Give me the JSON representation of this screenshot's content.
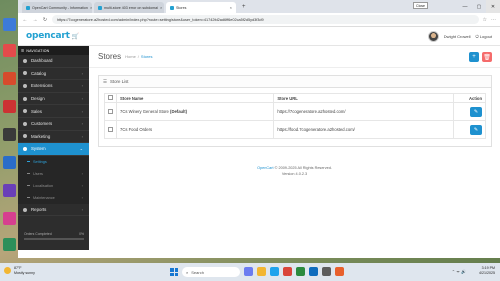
{
  "browser": {
    "tabs": [
      {
        "label": "OpenCart Community - Information",
        "active": false
      },
      {
        "label": "multi-store 403 error on subdomai",
        "active": false
      },
      {
        "label": "Stores",
        "active": true
      }
    ],
    "close_tooltip": "Close",
    "url": "https://7cogeneratore.a2hosted.com/admin/index.php?route=setting/store&user_token=41742fd2ad6ff6e02ca5f2d5yd3f3d9"
  },
  "header": {
    "logo": "opencart",
    "user_name": "Dwight Crowell",
    "logout_label": "Logout"
  },
  "sidebar": {
    "nav_title": "NAVIGATION",
    "items": [
      {
        "label": "Dashboard",
        "icon": "dashboard-icon",
        "chevron": false
      },
      {
        "label": "Catalog",
        "icon": "tags-icon",
        "chevron": true
      },
      {
        "label": "Extensions",
        "icon": "puzzle-icon",
        "chevron": true
      },
      {
        "label": "Design",
        "icon": "monitor-icon",
        "chevron": true
      },
      {
        "label": "Sales",
        "icon": "cart-icon",
        "chevron": true
      },
      {
        "label": "Customers",
        "icon": "user-icon",
        "chevron": true
      },
      {
        "label": "Marketing",
        "icon": "share-icon",
        "chevron": true
      },
      {
        "label": "System",
        "icon": "cog-icon",
        "chevron": true
      }
    ],
    "sub_items": [
      {
        "label": "Settings",
        "active": true,
        "chevron": false
      },
      {
        "label": "Users",
        "active": false,
        "chevron": true
      },
      {
        "label": "Localisation",
        "active": false,
        "chevron": true
      },
      {
        "label": "Maintenance",
        "active": false,
        "chevron": true
      }
    ],
    "reports_label": "Reports",
    "orders_completed_label": "Orders Completed",
    "orders_completed_value": "0%",
    "orders_completed_fraction": 0
  },
  "page": {
    "title": "Stores",
    "breadcrumb_home": "Home",
    "breadcrumb_current": "Stores",
    "panel_title": "Store List",
    "table": {
      "headers": [
        "Store Name",
        "Store URL",
        "Action"
      ],
      "rows": [
        {
          "name": "7Cs Winery General Store",
          "suffix": "(Default)",
          "url": "https://7cogeneratore.a2hosted.com/"
        },
        {
          "name": "7Cs Food Orders",
          "suffix": "",
          "url": "https://food.7cogeneratore.a2hosted.com/"
        }
      ]
    },
    "footer_brand": "OpenCart",
    "footer_copy": "© 2009-2025 All Rights Reserved.",
    "footer_version": "Version 4.0.2.3"
  },
  "taskbar": {
    "weather_temp": "87°F",
    "weather_desc": "Mostly sunny",
    "search_placeholder": "Search",
    "time": "3:19 PM",
    "date": "4/21/2025"
  },
  "colors": {
    "accent": "#1e91cf",
    "danger": "#f56b6b",
    "sidebar_bg": "#2d2d2d"
  }
}
